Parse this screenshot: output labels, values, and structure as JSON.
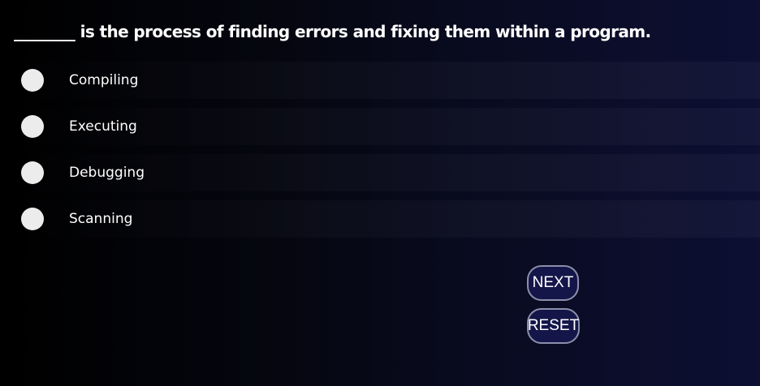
{
  "question": {
    "text": "________ is the process of finding errors and fixing them within a program."
  },
  "options": [
    {
      "label": "Compiling"
    },
    {
      "label": "Executing"
    },
    {
      "label": "Debugging"
    },
    {
      "label": "Scanning"
    }
  ],
  "buttons": {
    "next_label": "NEXT",
    "reset_label": "RESET"
  },
  "colors": {
    "background_start": "#000000",
    "background_end": "#0d0f33",
    "button_fill": "#14164a",
    "radio_fill": "#ececec"
  }
}
